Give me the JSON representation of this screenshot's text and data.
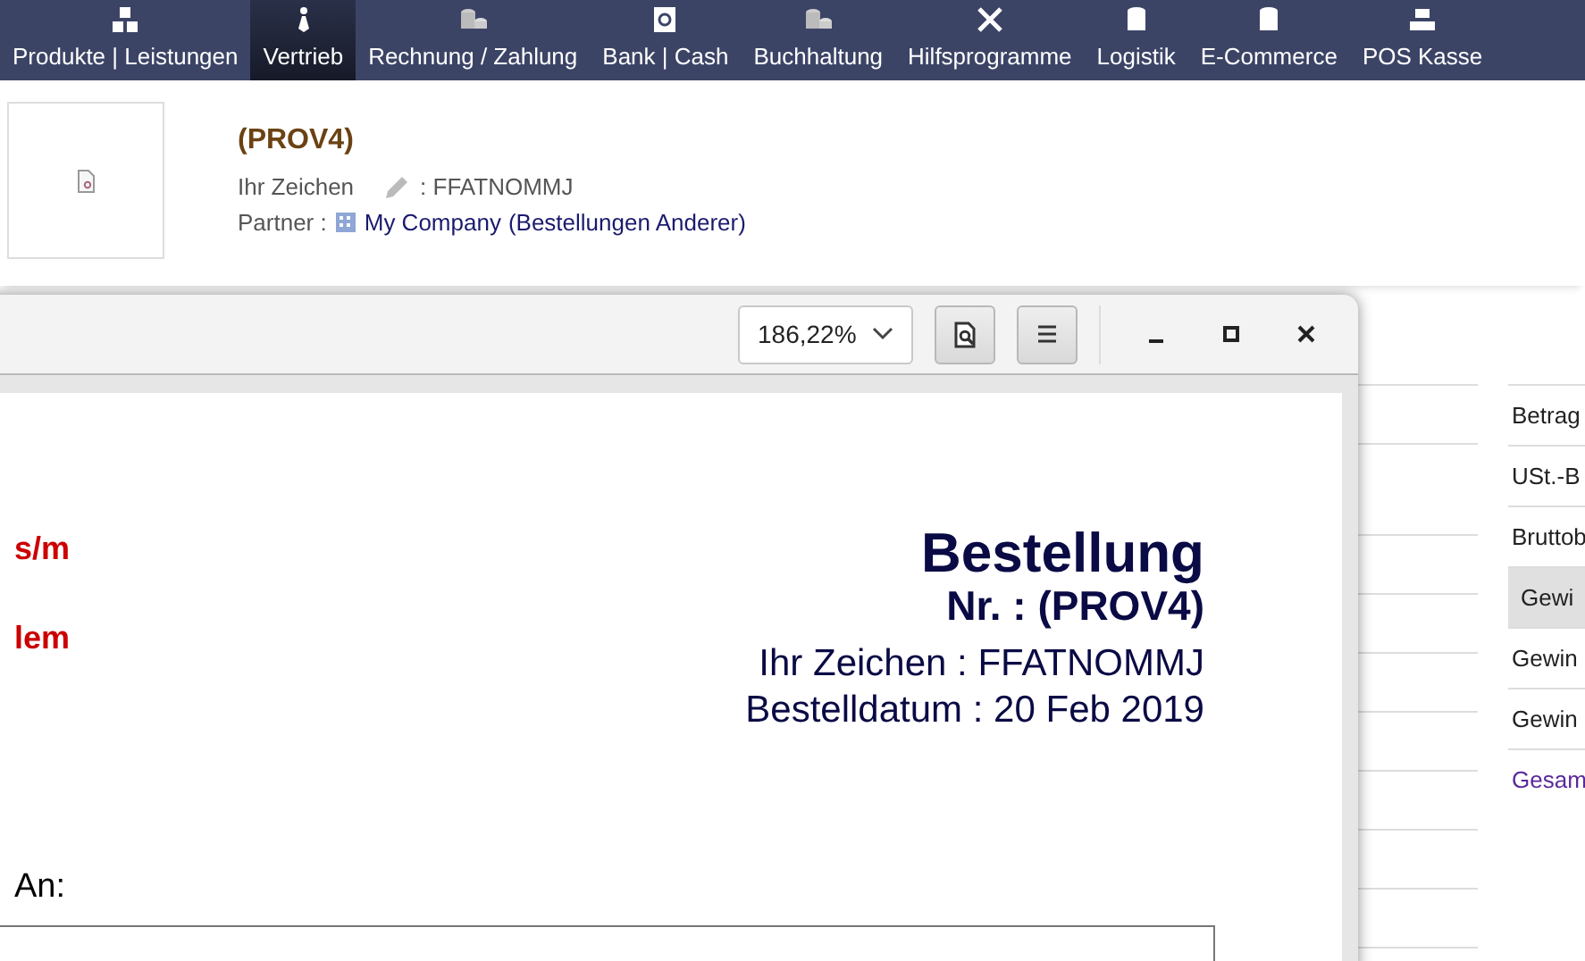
{
  "nav": [
    {
      "label": "Produkte | Leistungen",
      "selected": false
    },
    {
      "label": "Vertrieb",
      "selected": true
    },
    {
      "label": "Rechnung / Zahlung",
      "selected": false
    },
    {
      "label": "Bank | Cash",
      "selected": false
    },
    {
      "label": "Buchhaltung",
      "selected": false
    },
    {
      "label": "Hilfsprogramme",
      "selected": false
    },
    {
      "label": "Logistik",
      "selected": false
    },
    {
      "label": "E-Commerce",
      "selected": false
    },
    {
      "label": "POS Kasse",
      "selected": false
    }
  ],
  "record": {
    "title": "(PROV4)",
    "ref_label": "Ihr Zeichen",
    "ref_value": ": FFATNOMMJ",
    "partner_label": "Partner :",
    "partner_link": "My Company",
    "others_link": "(Bestellungen Anderer)"
  },
  "viewer": {
    "zoom": "186,22%"
  },
  "document": {
    "left_lines": [
      "s/m",
      "lem"
    ],
    "title": "Bestellung",
    "number": "Nr. : (PROV4)",
    "ref": "Ihr Zeichen : FFATNOMMJ",
    "date": "Bestelldatum : 20 Feb 2019",
    "recipient_label": "An:"
  },
  "side_table": [
    {
      "label": "Betrag",
      "selected": false,
      "kind": "text"
    },
    {
      "label": "USt.-B",
      "selected": false,
      "kind": "text"
    },
    {
      "label": "Bruttob",
      "selected": false,
      "kind": "text"
    },
    {
      "label": "Gewi",
      "selected": true,
      "kind": "text"
    },
    {
      "label": "Gewin",
      "selected": false,
      "kind": "text"
    },
    {
      "label": "Gewin",
      "selected": false,
      "kind": "text"
    },
    {
      "label": "Gesam",
      "selected": false,
      "kind": "link"
    }
  ]
}
